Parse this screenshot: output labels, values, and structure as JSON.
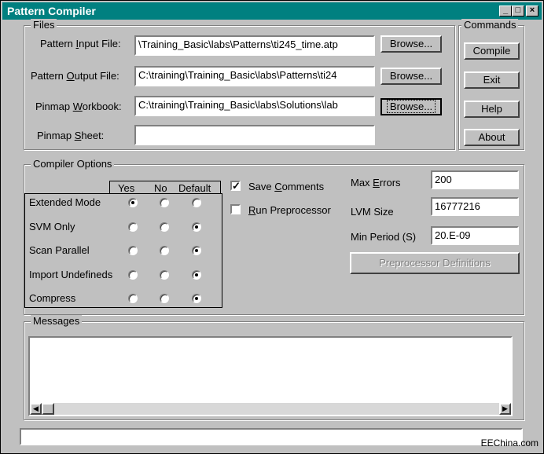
{
  "window": {
    "title": "Pattern Compiler"
  },
  "files": {
    "legend": "Files",
    "pattern_input_label_pre": "Pattern ",
    "pattern_input_label_u": "I",
    "pattern_input_label_post": "nput File:",
    "pattern_input_value": "\\Training_Basic\\labs\\Patterns\\ti245_time.atp",
    "pattern_output_label_pre": "Pattern ",
    "pattern_output_label_u": "O",
    "pattern_output_label_post": "utput File:",
    "pattern_output_value": "C:\\training\\Training_Basic\\labs\\Patterns\\ti24",
    "pinmap_workbook_label_pre": "Pinmap ",
    "pinmap_workbook_label_u": "W",
    "pinmap_workbook_label_post": "orkbook:",
    "pinmap_workbook_value": "C:\\training\\Training_Basic\\labs\\Solutions\\lab",
    "pinmap_sheet_label_pre": "Pinmap ",
    "pinmap_sheet_label_u": "S",
    "pinmap_sheet_label_post": "heet:",
    "pinmap_sheet_value": "",
    "browse_label": "Browse..."
  },
  "commands": {
    "legend": "Commands",
    "compile": "Compile",
    "exit": "Exit",
    "help": "Help",
    "about": "About"
  },
  "options": {
    "legend": "Compiler Options",
    "col_yes": "Yes",
    "col_no": "No",
    "col_default": "Default",
    "rows": [
      {
        "label": "Extended Mode",
        "selected": "yes"
      },
      {
        "label": "SVM Only",
        "selected": "default"
      },
      {
        "label": "Scan Parallel",
        "selected": "default"
      },
      {
        "label": "Import Undefineds",
        "selected": "default"
      },
      {
        "label": "Compress",
        "selected": "default"
      }
    ],
    "save_comments_pre": "Save ",
    "save_comments_u": "C",
    "save_comments_post": "omments",
    "save_comments_checked": true,
    "run_preprocessor_u": "R",
    "run_preprocessor_post": "un Preprocessor",
    "run_preprocessor_checked": false,
    "max_errors_pre": "Max ",
    "max_errors_u": "E",
    "max_errors_post": "rrors",
    "max_errors_value": "200",
    "lvm_size_label": "LVM Size",
    "lvm_size_value": "16777216",
    "min_period_label": "Min Period (S)",
    "min_period_value": "20.E-09",
    "preprocessor_definitions": "Preprocessor Definitions"
  },
  "messages": {
    "legend": "Messages",
    "content": ""
  },
  "status_text": "",
  "watermark": "EEChina.com"
}
